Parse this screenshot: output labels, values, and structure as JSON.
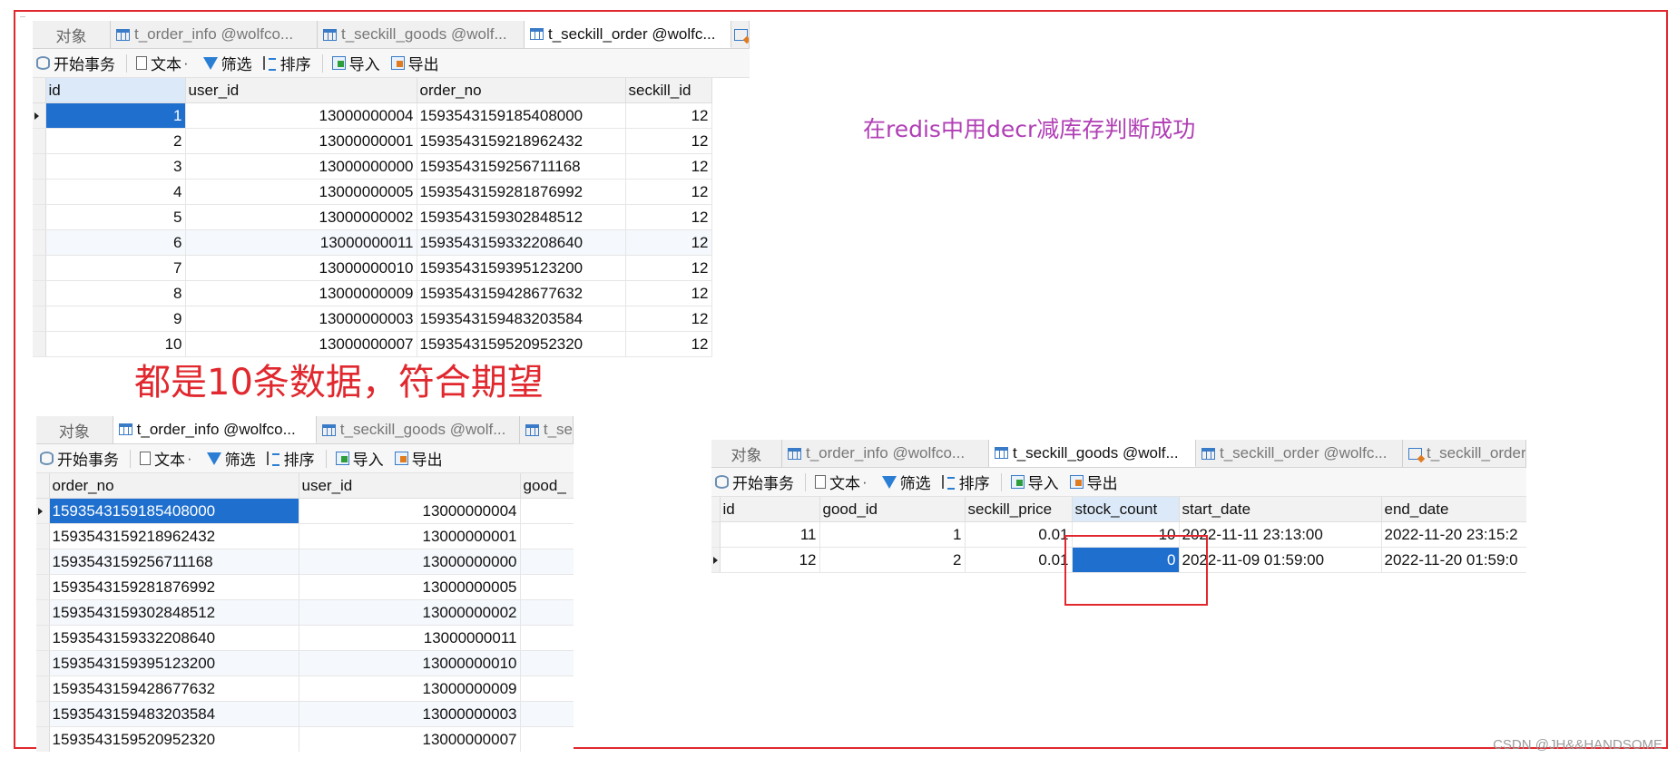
{
  "shared": {
    "objects_tab": "对象",
    "toolbar": {
      "begin_tx": "开始事务",
      "text": "文本",
      "filter": "筛选",
      "sort": "排序",
      "import": "导入",
      "export": "导出"
    }
  },
  "order_panel": {
    "tabs": [
      "t_order_info @wolfco...",
      "t_seckill_goods @wolf...",
      "t_seckill_order @wolfc..."
    ],
    "columns": [
      "id",
      "user_id",
      "order_no",
      "seckill_id"
    ],
    "rows": [
      [
        "1",
        "13000000004",
        "1593543159185408000",
        "12"
      ],
      [
        "2",
        "13000000001",
        "1593543159218962432",
        "12"
      ],
      [
        "3",
        "13000000000",
        "1593543159256711168",
        "12"
      ],
      [
        "4",
        "13000000005",
        "1593543159281876992",
        "12"
      ],
      [
        "5",
        "13000000002",
        "1593543159302848512",
        "12"
      ],
      [
        "6",
        "13000000011",
        "1593543159332208640",
        "12"
      ],
      [
        "7",
        "13000000010",
        "1593543159395123200",
        "12"
      ],
      [
        "8",
        "13000000009",
        "1593543159428677632",
        "12"
      ],
      [
        "9",
        "13000000003",
        "1593543159483203584",
        "12"
      ],
      [
        "10",
        "13000000007",
        "1593543159520952320",
        "12"
      ]
    ]
  },
  "info_panel": {
    "tabs": [
      "t_order_info @wolfco...",
      "t_seckill_goods @wolf...",
      "t_se"
    ],
    "columns": [
      "order_no",
      "user_id",
      "good_"
    ],
    "rows": [
      [
        "1593543159185408000",
        "13000000004"
      ],
      [
        "1593543159218962432",
        "13000000001"
      ],
      [
        "1593543159256711168",
        "13000000000"
      ],
      [
        "1593543159281876992",
        "13000000005"
      ],
      [
        "1593543159302848512",
        "13000000002"
      ],
      [
        "1593543159332208640",
        "13000000011"
      ],
      [
        "1593543159395123200",
        "13000000010"
      ],
      [
        "1593543159428677632",
        "13000000009"
      ],
      [
        "1593543159483203584",
        "13000000003"
      ],
      [
        "1593543159520952320",
        "13000000007"
      ]
    ]
  },
  "goods_panel": {
    "tabs": [
      "t_order_info @wolfco...",
      "t_seckill_goods @wolf...",
      "t_seckill_order @wolfc...",
      "t_seckill_order"
    ],
    "columns": [
      "id",
      "good_id",
      "seckill_price",
      "stock_count",
      "start_date",
      "end_date"
    ],
    "rows": [
      [
        "11",
        "1",
        "0.01",
        "10",
        "2022-11-11 23:13:00",
        "2022-11-20 23:15:2"
      ],
      [
        "12",
        "2",
        "0.01",
        "0",
        "2022-11-09 01:59:00",
        "2022-11-20 01:59:0"
      ]
    ]
  },
  "annotations": {
    "redis_note": "在redis中用decr减库存判断成功",
    "count_note": "都是10条数据，符合期望"
  },
  "watermark": "CSDN @JH&&HANDSOME",
  "colors": {
    "annotation_red": "#e0282e",
    "annotation_purple": "#b03fb5",
    "selection_blue": "#1f6fcf"
  }
}
